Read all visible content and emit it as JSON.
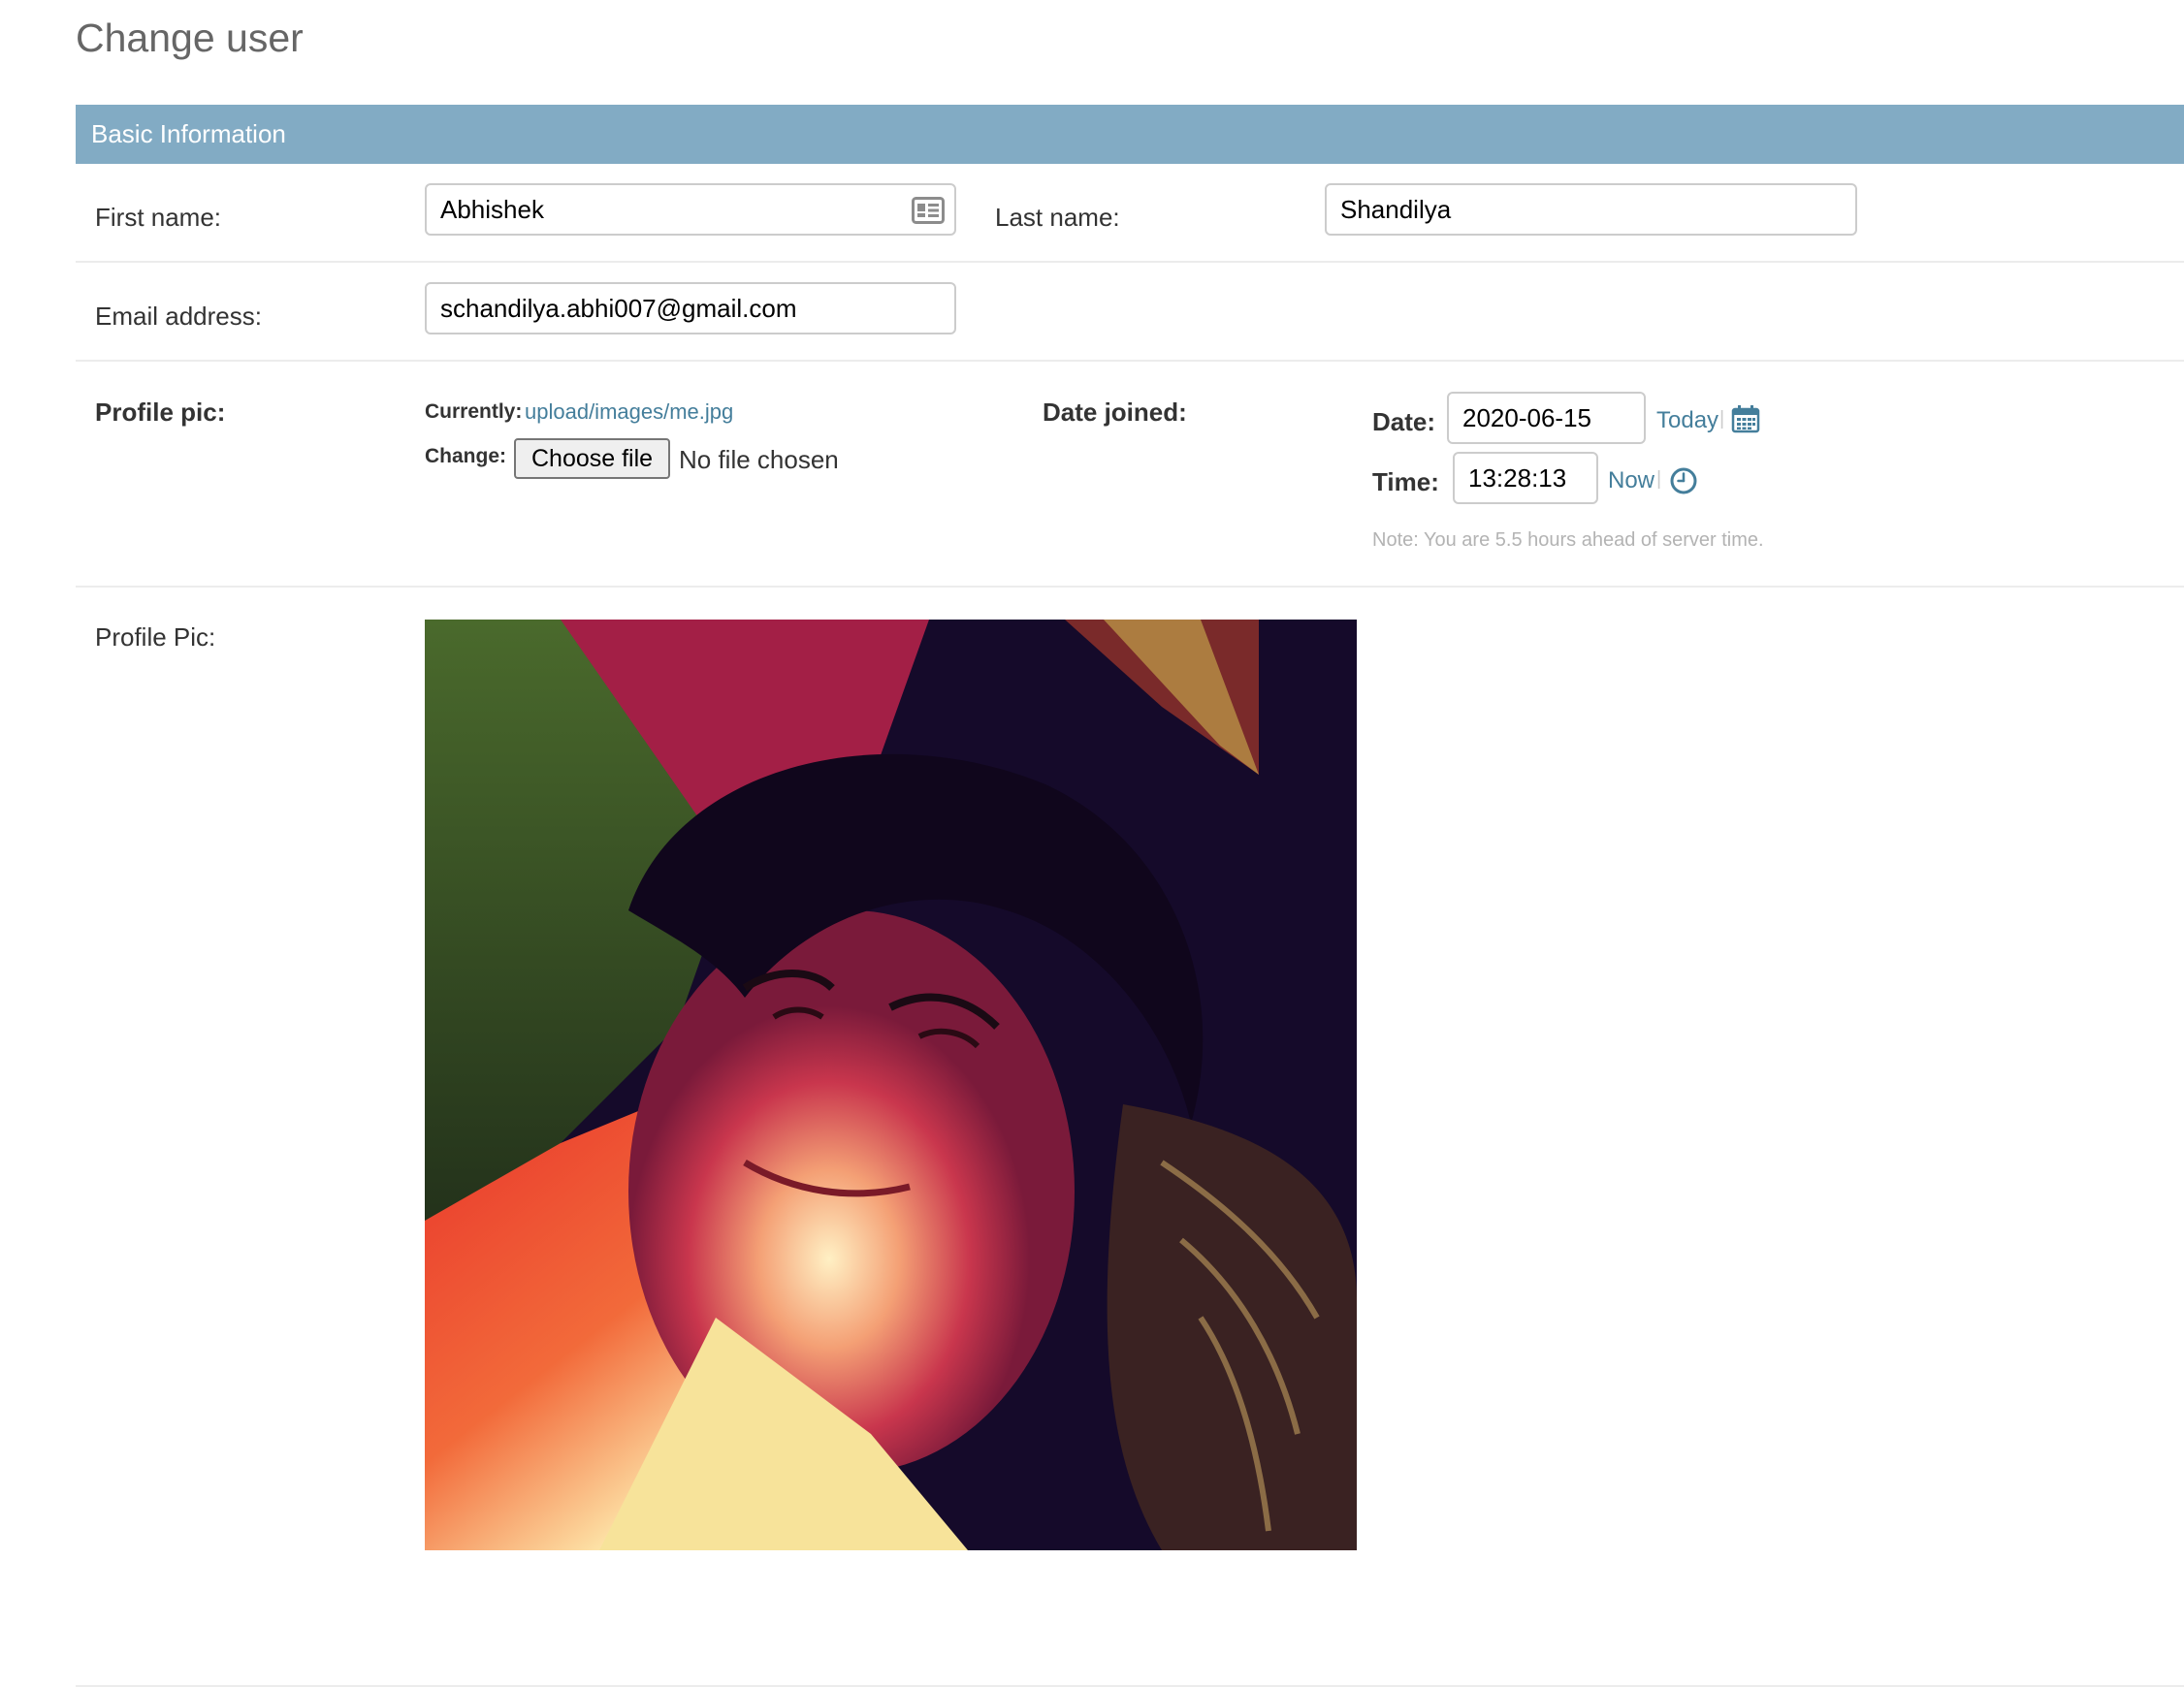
{
  "page": {
    "title": "Change user"
  },
  "fieldset": {
    "heading": "Basic Information"
  },
  "fields": {
    "first_name": {
      "label": "First name:",
      "value": "Abhishek"
    },
    "last_name": {
      "label": "Last name:",
      "value": "Shandilya"
    },
    "email": {
      "label": "Email address:",
      "value": "schandilya.abhi007@gmail.com"
    },
    "profile_pic_upload": {
      "label": "Profile pic:",
      "currently_label": "Currently:",
      "current_file": "upload/images/me.jpg",
      "change_label": "Change:",
      "choose_button": "Choose file",
      "file_status": "No file chosen"
    },
    "date_joined": {
      "label": "Date joined:",
      "date_label": "Date:",
      "date_value": "2020-06-15",
      "today_link": "Today",
      "time_label": "Time:",
      "time_value": "13:28:13",
      "now_link": "Now",
      "separator": "|",
      "note": "Note: You are 5.5 hours ahead of server time."
    },
    "profile_pic_preview": {
      "label": "Profile Pic:"
    }
  },
  "icons": {
    "autofill": "contact-card-icon",
    "calendar": "calendar-icon",
    "clock": "clock-icon"
  },
  "colors": {
    "module_header": "#82abc4",
    "link": "#447e9b",
    "help_text": "#b3b3b3"
  }
}
